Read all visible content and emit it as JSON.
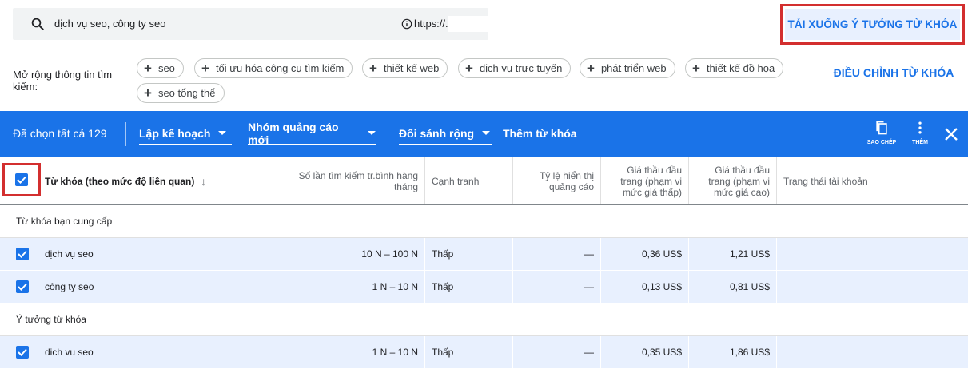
{
  "search": {
    "query": "dịch vụ seo, công ty seo",
    "url": "https://."
  },
  "download_button": "TẢI XUỐNG Ý TƯỞNG TỪ KHÓA",
  "expand": {
    "label": "Mở rộng thông tin tìm kiếm:",
    "chips": [
      "seo",
      "tối ưu hóa công cụ tìm kiếm",
      "thiết kế web",
      "dịch vụ trực tuyến",
      "phát triển web",
      "thiết kế đồ họa",
      "seo tổng thể"
    ],
    "adjust_button": "ĐIỀU CHỈNH TỪ KHÓA"
  },
  "toolbar": {
    "selected_text": "Đã chọn tất cả 129",
    "plan_dropdown": "Lập kế hoạch",
    "adgroup_dropdown": "Nhóm quảng cáo mới",
    "match_dropdown": "Đối sánh rộng",
    "add_keywords": "Thêm từ khóa",
    "copy_label": "SAO CHÉP",
    "more_label": "THÊM"
  },
  "table": {
    "columns": [
      "Từ khóa (theo mức độ liên quan)",
      "Số lần tìm kiếm tr.bình hàng tháng",
      "Cạnh tranh",
      "Tỷ lệ hiển thị quảng cáo",
      "Giá thầu đầu trang (phạm vi mức giá thấp)",
      "Giá thầu đầu trang (phạm vi mức giá cao)",
      "Trạng thái tài khoản"
    ],
    "groups": [
      {
        "title": "Từ khóa bạn cung cấp",
        "rows": [
          {
            "keyword": "dịch vụ seo",
            "searches": "10 N – 100 N",
            "competition": "Thấp",
            "impression_share": "—",
            "bid_low": "0,36 US$",
            "bid_high": "1,21 US$",
            "status": ""
          },
          {
            "keyword": "công ty seo",
            "searches": "1 N – 10 N",
            "competition": "Thấp",
            "impression_share": "—",
            "bid_low": "0,13 US$",
            "bid_high": "0,81 US$",
            "status": ""
          }
        ]
      },
      {
        "title": "Ý tưởng từ khóa",
        "rows": [
          {
            "keyword": "dich vu seo",
            "searches": "1 N – 10 N",
            "competition": "Thấp",
            "impression_share": "—",
            "bid_low": "0,35 US$",
            "bid_high": "1,86 US$",
            "status": ""
          }
        ]
      }
    ]
  },
  "colors": {
    "accent": "#1a73e8",
    "highlight_border": "#d32f2f",
    "row_bg": "#e8f0fe"
  }
}
